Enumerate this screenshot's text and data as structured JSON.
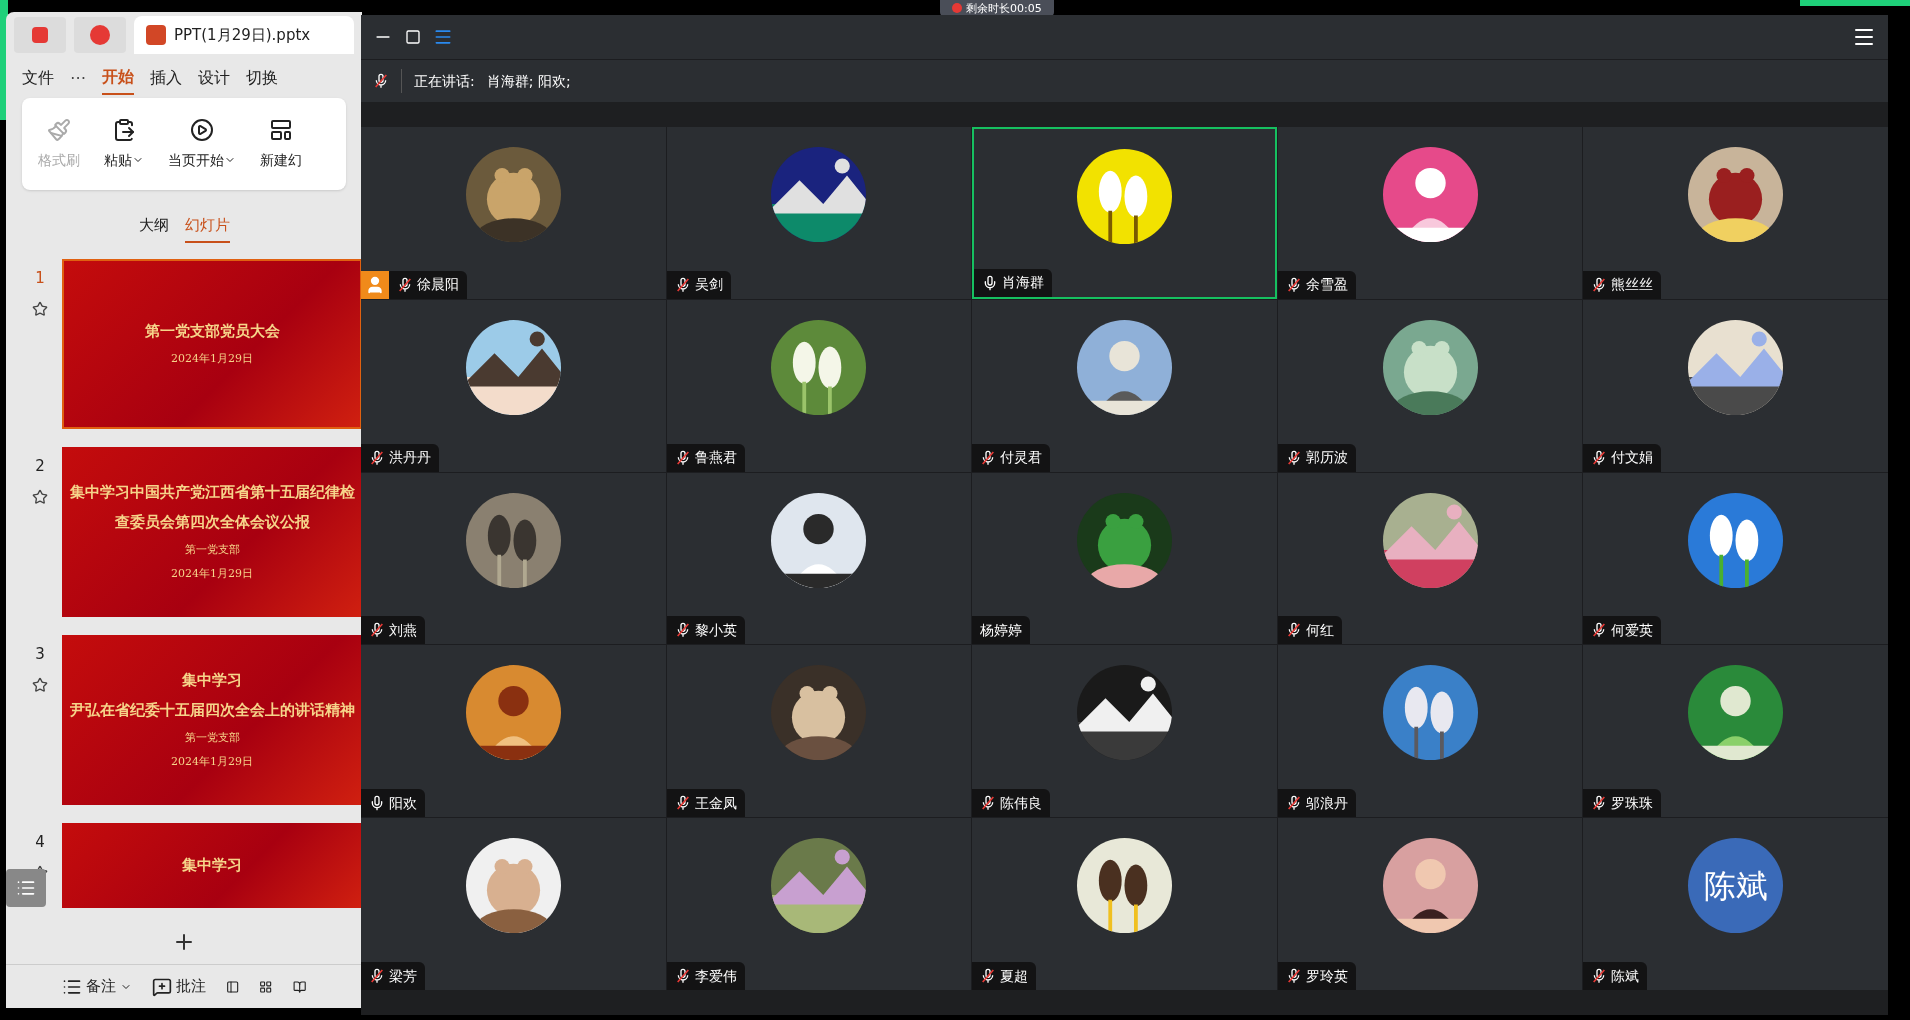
{
  "desktop": {
    "timer": "剩余时长00:05"
  },
  "wps": {
    "tabs": [
      {
        "label": "PPT(1月29日).pptx",
        "selected": true
      }
    ],
    "more": "⋯",
    "menu": [
      {
        "label": "文件",
        "selected": false
      },
      {
        "label": "开始",
        "selected": true
      },
      {
        "label": "插入",
        "selected": false
      },
      {
        "label": "设计",
        "selected": false
      },
      {
        "label": "切换",
        "selected": false
      }
    ],
    "ribbon": [
      {
        "label": "格式刷",
        "disabled": true,
        "dropdown": false
      },
      {
        "label": "粘贴",
        "disabled": false,
        "dropdown": true
      },
      {
        "label": "当页开始",
        "disabled": false,
        "dropdown": true
      },
      {
        "label": "新建幻",
        "disabled": false,
        "dropdown": false
      }
    ],
    "panel_tabs": [
      {
        "label": "大纲",
        "selected": false
      },
      {
        "label": "幻灯片",
        "selected": true
      }
    ],
    "slides": [
      {
        "number": "1",
        "selected": true,
        "lines": [
          {
            "kind": "title",
            "text": "第一党支部党员大会"
          },
          {
            "kind": "sub",
            "text": "2024年1月29日"
          }
        ]
      },
      {
        "number": "2",
        "selected": false,
        "lines": [
          {
            "kind": "title",
            "text": "集中学习中国共产党江西省第十五届纪律检"
          },
          {
            "kind": "title",
            "text": "查委员会第四次全体会议公报"
          },
          {
            "kind": "sub",
            "text": "第一党支部"
          },
          {
            "kind": "sub",
            "text": "2024年1月29日"
          }
        ]
      },
      {
        "number": "3",
        "selected": false,
        "lines": [
          {
            "kind": "title",
            "text": "集中学习"
          },
          {
            "kind": "title",
            "text": "尹弘在省纪委十五届四次全会上的讲话精神"
          },
          {
            "kind": "sub",
            "text": "第一党支部"
          },
          {
            "kind": "sub",
            "text": "2024年1月29日"
          }
        ]
      },
      {
        "number": "4",
        "selected": false,
        "lines": [
          {
            "kind": "title",
            "text": "集中学习"
          }
        ]
      }
    ],
    "status_bar": [
      {
        "label": "备注",
        "dropdown": true
      },
      {
        "label": "批注",
        "dropdown": false
      }
    ]
  },
  "meeting": {
    "speaking_label": "正在讲话:",
    "speakers": "肖海群; 阳欢;",
    "participants": [
      {
        "name": "徐晨阳",
        "kind": "muted",
        "host": true,
        "selected": false
      },
      {
        "name": "吴剑",
        "kind": "muted",
        "host": false,
        "selected": false
      },
      {
        "name": "肖海群",
        "kind": "speaking",
        "host": false,
        "selected": true
      },
      {
        "name": "余雪盈",
        "kind": "muted",
        "host": false,
        "selected": false
      },
      {
        "name": "熊丝丝",
        "kind": "muted",
        "host": false,
        "selected": false
      },
      {
        "name": "洪丹丹",
        "kind": "muted",
        "host": false,
        "selected": false
      },
      {
        "name": "鲁燕君",
        "kind": "muted",
        "host": false,
        "selected": false
      },
      {
        "name": "付灵君",
        "kind": "muted",
        "host": false,
        "selected": false
      },
      {
        "name": "郭历波",
        "kind": "muted",
        "host": false,
        "selected": false
      },
      {
        "name": "付文娟",
        "kind": "muted",
        "host": false,
        "selected": false
      },
      {
        "name": "刘燕",
        "kind": "muted",
        "host": false,
        "selected": false
      },
      {
        "name": "黎小英",
        "kind": "muted",
        "host": false,
        "selected": false
      },
      {
        "name": "杨婷婷",
        "kind": "silent",
        "host": false,
        "selected": false
      },
      {
        "name": "何红",
        "kind": "muted",
        "host": false,
        "selected": false
      },
      {
        "name": "何爱英",
        "kind": "muted",
        "host": false,
        "selected": false
      },
      {
        "name": "阳欢",
        "kind": "speaking",
        "host": false,
        "selected": false
      },
      {
        "name": "王金凤",
        "kind": "muted",
        "host": false,
        "selected": false
      },
      {
        "name": "陈伟良",
        "kind": "muted",
        "host": false,
        "selected": false
      },
      {
        "name": "邬浪丹",
        "kind": "muted",
        "host": false,
        "selected": false
      },
      {
        "name": "罗珠珠",
        "kind": "muted",
        "host": false,
        "selected": false
      },
      {
        "name": "梁芳",
        "kind": "muted",
        "host": false,
        "selected": false
      },
      {
        "name": "李爱伟",
        "kind": "muted",
        "host": false,
        "selected": false
      },
      {
        "name": "夏超",
        "kind": "muted",
        "host": false,
        "selected": false
      },
      {
        "name": "罗玲英",
        "kind": "muted",
        "host": false,
        "selected": false
      },
      {
        "name": "陈斌",
        "kind": "muted",
        "host": false,
        "selected": false,
        "avatar": {
          "kind": "text",
          "text": "陈斌"
        }
      }
    ]
  }
}
